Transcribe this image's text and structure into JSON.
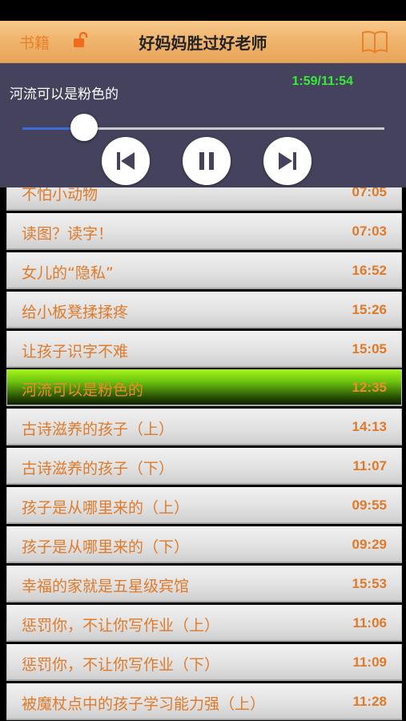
{
  "nav": {
    "left_label": "书籍",
    "title": "好妈妈胜过好老师",
    "lock_icon": "unlock-icon",
    "book_icon": "book-icon"
  },
  "player": {
    "now_playing": "河流可以是粉色的",
    "time": "1:59/11:54",
    "progress_fraction": 0.17,
    "prev_icon": "skip-previous-icon",
    "pause_icon": "pause-icon",
    "next_icon": "skip-next-icon"
  },
  "tracks": [
    {
      "title": "不怕小动物",
      "duration": "07:05"
    },
    {
      "title": "读图？读字！",
      "duration": "07:03"
    },
    {
      "title": "女儿的“隐私”",
      "duration": "16:52"
    },
    {
      "title": "给小板凳揉揉疼",
      "duration": "15:26"
    },
    {
      "title": "让孩子识字不难",
      "duration": "15:05"
    },
    {
      "title": "河流可以是粉色的",
      "duration": "12:35",
      "active": true
    },
    {
      "title": "古诗滋养的孩子（上）",
      "duration": "14:13"
    },
    {
      "title": "古诗滋养的孩子（下）",
      "duration": "11:07"
    },
    {
      "title": "孩子是从哪里来的（上）",
      "duration": "09:55"
    },
    {
      "title": "孩子是从哪里来的（下）",
      "duration": "09:29"
    },
    {
      "title": "幸福的家就是五星级宾馆",
      "duration": "15:53"
    },
    {
      "title": "惩罚你，不让你写作业（上）",
      "duration": "11:06"
    },
    {
      "title": "惩罚你，不让你写作业（下）",
      "duration": "11:09"
    },
    {
      "title": "被魔杖点中的孩子学习能力强（上）",
      "duration": "11:28"
    }
  ],
  "colors": {
    "accent": "#e07a2a",
    "time_green": "#39e83a",
    "player_bg": "#44425c",
    "progress_blue": "#3a6bd8"
  }
}
